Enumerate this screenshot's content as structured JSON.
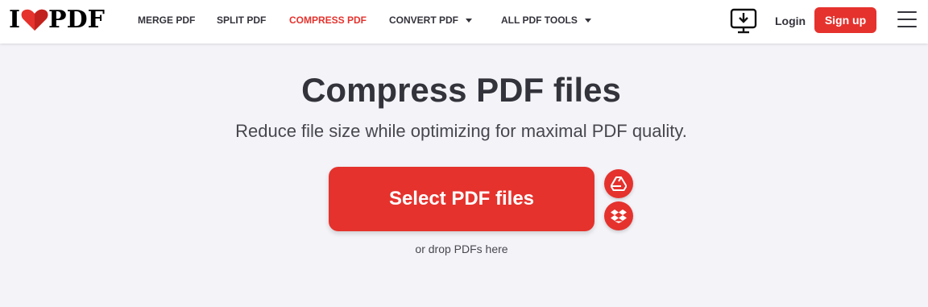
{
  "logo": {
    "prefix": "I",
    "suffix": "PDF",
    "heart_color": "#e5322d"
  },
  "nav": {
    "merge": "MERGE PDF",
    "split": "SPLIT PDF",
    "compress": "COMPRESS PDF",
    "convert": "CONVERT PDF",
    "all_tools": "ALL PDF TOOLS"
  },
  "header_actions": {
    "desktop_icon": "desktop-download-icon",
    "login": "Login",
    "signup": "Sign up",
    "menu_icon": "hamburger-menu-icon"
  },
  "main": {
    "title": "Compress PDF files",
    "subtitle": "Reduce file size while optimizing for maximal PDF quality.",
    "select_button": "Select PDF files",
    "drop_hint": "or drop PDFs here",
    "cloud_sources": [
      "google-drive-icon",
      "dropbox-icon"
    ]
  },
  "colors": {
    "brand": "#e5322d",
    "background": "#f4f3f8",
    "text": "#33333b"
  }
}
